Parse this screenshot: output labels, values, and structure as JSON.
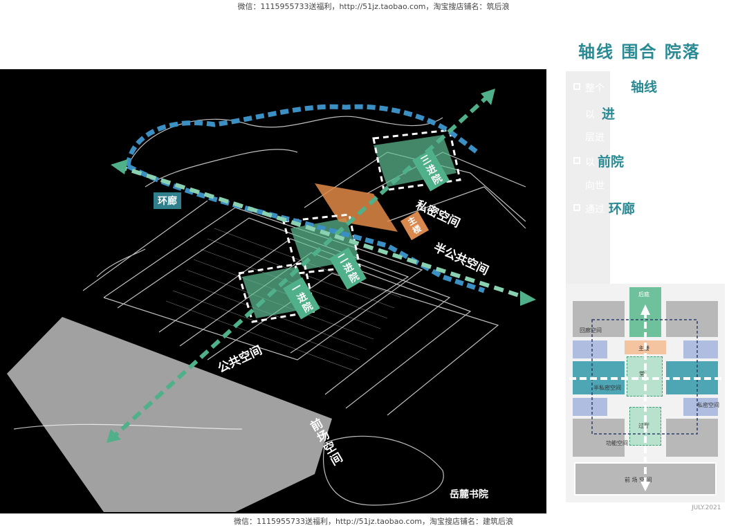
{
  "watermark": {
    "top": "微信：1115955733送福利，http://51jz.taobao.com，淘宝搜店铺名：筑后浪",
    "bottom": "微信：1115955733送福利，http://51jz.taobao.com，淘宝搜店铺名：建筑后浪"
  },
  "diagram": {
    "labels": {
      "huanlang": "环廊",
      "sanjinyuan": "三进院",
      "private_space": "私密空间",
      "main_building": "主楼",
      "erjinyuan": "二进院",
      "semi_public": "半公共空间",
      "yijinyuan": "一进院",
      "public_space": "公共空间",
      "front_square": "前场空间",
      "place_name": "岳麓书院"
    }
  },
  "right": {
    "title": "轴线  围合  院落",
    "ghost_lines": [
      "整个",
      "以",
      "层进",
      "以",
      "向世",
      "通过"
    ],
    "keywords": [
      "轴线",
      "进",
      "前院",
      "环廊"
    ]
  },
  "plan": {
    "labels": {
      "rear_court": "后庭",
      "main": "主楼",
      "hall": "堂",
      "semi_private": "半私密空间",
      "private": "私密空间",
      "passage": "过厅",
      "corridor": "回廊空间",
      "function": "功能空间",
      "front": "前  场  空  间"
    }
  },
  "date": "JULY.2021",
  "colors": {
    "teal": "#2a8a94",
    "green": "#4fb08a",
    "orange": "#d9894d",
    "blue_dash": "#3b8fc2"
  }
}
